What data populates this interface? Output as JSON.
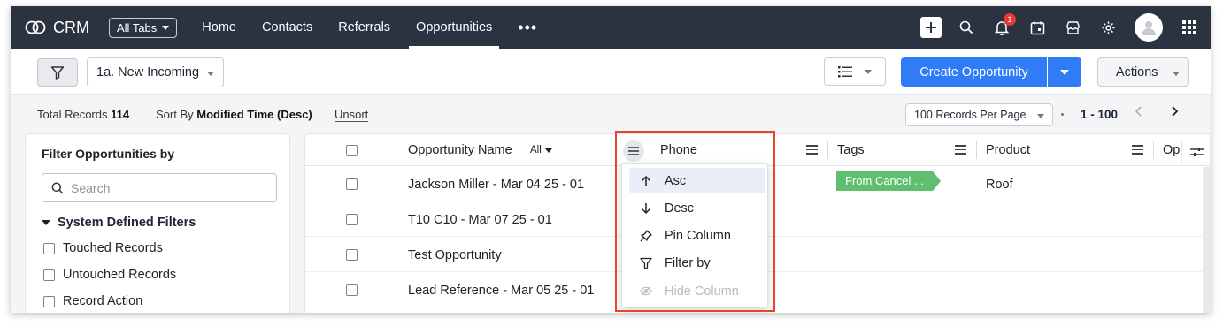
{
  "nav": {
    "app_name": "CRM",
    "all_tabs_label": "All Tabs",
    "tabs": [
      {
        "label": "Home"
      },
      {
        "label": "Contacts"
      },
      {
        "label": "Referrals"
      },
      {
        "label": "Opportunities",
        "active": true
      }
    ],
    "notification_count": "1"
  },
  "toolbar": {
    "view_label": "1a. New Incoming",
    "create_label": "Create Opportunity",
    "actions_label": "Actions"
  },
  "records": {
    "total_label": "Total Records",
    "total_value": "114",
    "sort_prefix": "Sort By",
    "sort_value": "Modified Time (Desc)",
    "unsort_label": "Unsort",
    "per_page_label": "100 Records Per Page",
    "range": "1 - 100"
  },
  "filter_panel": {
    "title": "Filter Opportunities by",
    "search_placeholder": "Search",
    "section_title": "System Defined Filters",
    "items": [
      "Touched Records",
      "Untouched Records",
      "Record Action"
    ]
  },
  "table": {
    "columns": {
      "name": "Opportunity Name",
      "name_filter": "All",
      "phone": "Phone",
      "tags": "Tags",
      "product": "Product",
      "next": "Op"
    },
    "rows": [
      {
        "name": "Jackson Miller - Mar 04 25 - 01",
        "tag": "From Cancel ...",
        "product": "Roof"
      },
      {
        "name": "T10 C10 - Mar 07 25 - 01",
        "tag": "",
        "product": ""
      },
      {
        "name": "Test Opportunity",
        "tag": "",
        "product": ""
      },
      {
        "name": "Lead Reference - Mar 05 25 - 01",
        "tag": "",
        "product": ""
      }
    ]
  },
  "column_menu": {
    "items": [
      {
        "label": "Asc",
        "icon": "arrow-up-icon",
        "state": "hover"
      },
      {
        "label": "Desc",
        "icon": "arrow-down-icon"
      },
      {
        "label": "Pin Column",
        "icon": "pin-icon"
      },
      {
        "label": "Filter by",
        "icon": "filter-icon"
      },
      {
        "label": "Hide Column",
        "icon": "eye-off-icon",
        "state": "disabled"
      }
    ]
  },
  "colors": {
    "nav_bg": "#2c3340",
    "primary": "#2f7cf6",
    "tag_green": "#5fbf6e",
    "highlight_red": "#e8432b"
  }
}
